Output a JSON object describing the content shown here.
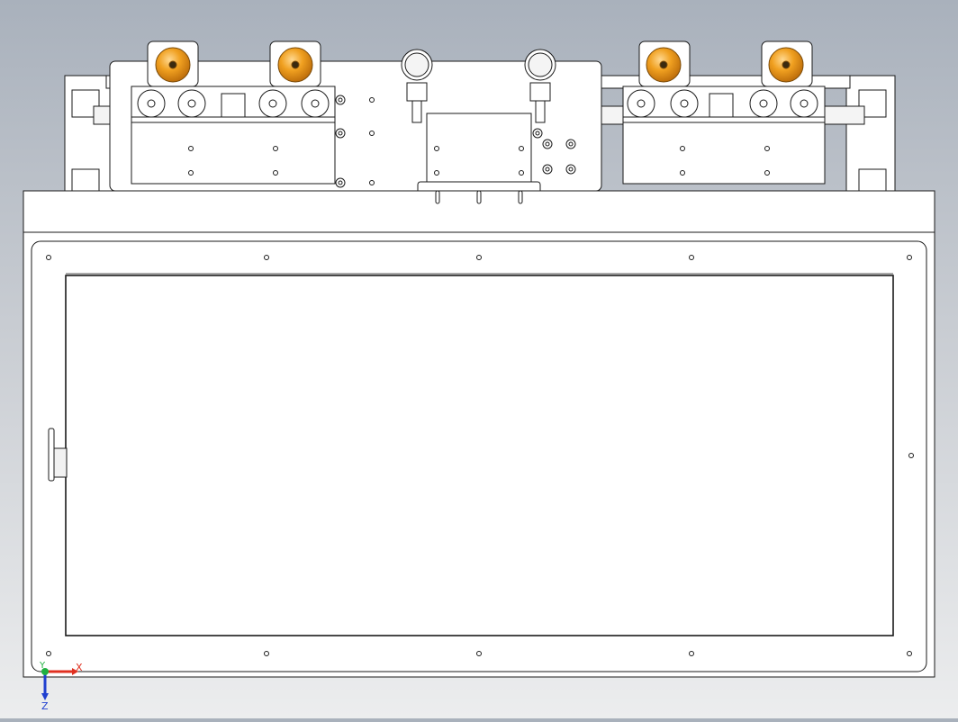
{
  "viewport": {
    "background": "gradient-gray",
    "triad": {
      "x_label": "X",
      "y_label": "Y",
      "z_label": "Z",
      "x_color": "#e03020",
      "y_color": "#20b040",
      "z_color": "#2040d0"
    }
  },
  "model": {
    "line_color": "#1a1a1a",
    "face_color": "#ffffff",
    "knob_color": "#e89a18"
  }
}
